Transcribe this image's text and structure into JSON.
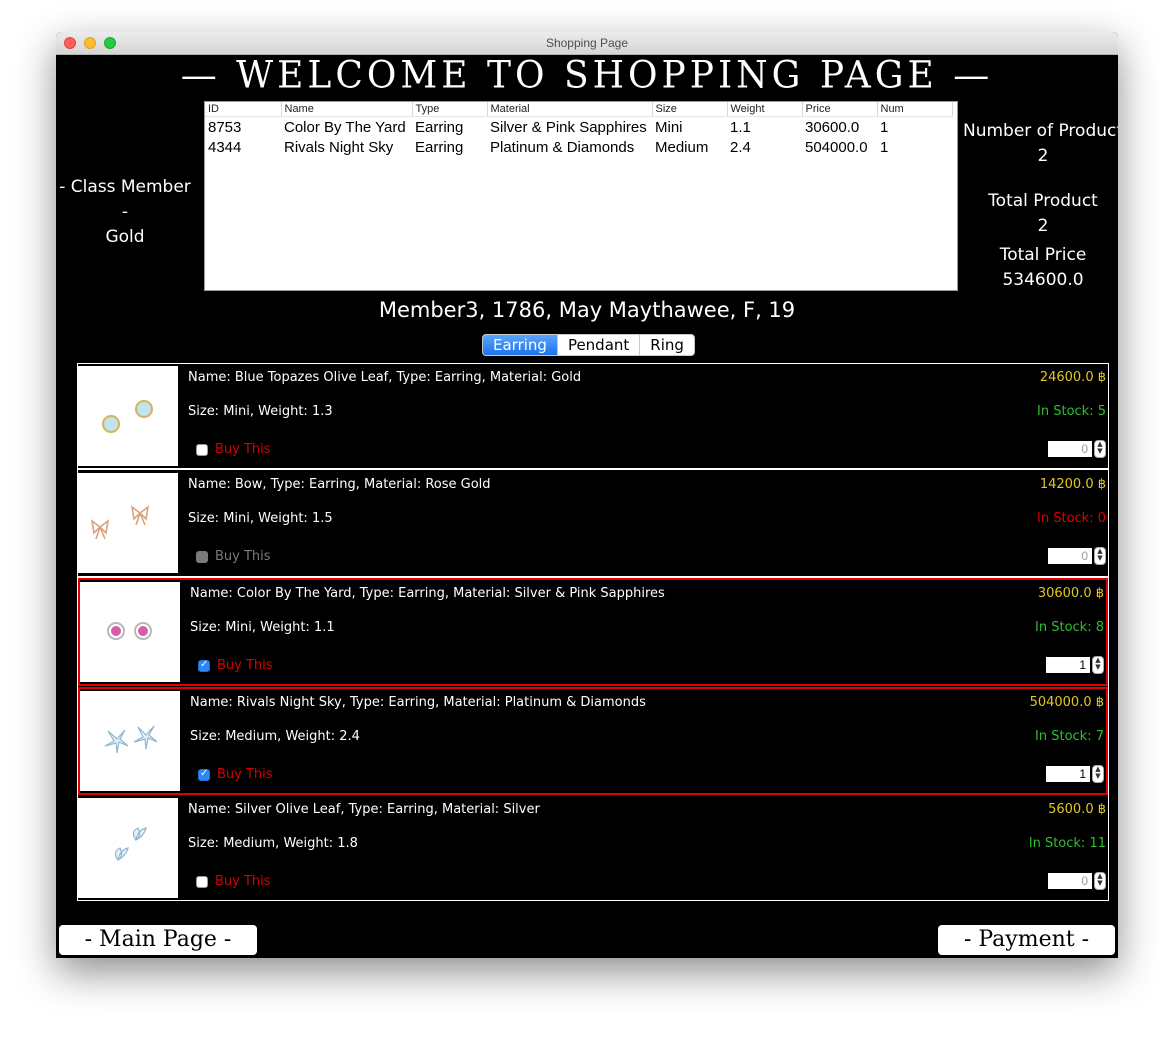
{
  "window": {
    "title": "Shopping Page"
  },
  "heading": "— WELCOME TO SHOPPING PAGE —",
  "member_class": {
    "label": "- Class Member -",
    "value": "Gold"
  },
  "cart_table": {
    "columns": [
      "ID",
      "Name",
      "Type",
      "Material",
      "Size",
      "Weight",
      "Price",
      "Num"
    ],
    "rows": [
      [
        "8753",
        "Color By The Yard",
        "Earring",
        "Silver & Pink Sapphires",
        "Mini",
        "1.1",
        "30600.0",
        "1"
      ],
      [
        "4344",
        "Rivals Night Sky",
        "Earring",
        "Platinum & Diamonds",
        "Medium",
        "2.4",
        "504000.0",
        "1"
      ]
    ]
  },
  "summary": {
    "num_product_label": "Number of Product",
    "num_product_value": "2",
    "total_product_label": "Total Product",
    "total_product_value": "2",
    "total_price_label": "Total Price",
    "total_price_value": "534600.0"
  },
  "member_info": "Member3, 1786, May Maythawee, F, 19",
  "tabs": [
    {
      "label": "Earring",
      "active": true
    },
    {
      "label": "Pendant",
      "active": false
    },
    {
      "label": "Ring",
      "active": false
    }
  ],
  "products": [
    {
      "name_line": "Name: Blue Topazes Olive Leaf, Type: Earring, Material: Gold",
      "size_line": "Size: Mini, Weight: 1.3",
      "price": "24600.0 ฿",
      "stock": "In Stock: 5",
      "buy_label": "Buy This",
      "qty": "0",
      "checked": false,
      "selected": false,
      "in_stock": true,
      "icon": "earring-icon"
    },
    {
      "name_line": "Name: Bow, Type: Earring, Material: Rose Gold",
      "size_line": "Size: Mini, Weight: 1.5",
      "price": "14200.0 ฿",
      "stock": "In Stock: 0",
      "buy_label": "Buy This",
      "qty": "0",
      "checked": false,
      "selected": false,
      "in_stock": false,
      "icon": "bow-earring-icon"
    },
    {
      "name_line": "Name: Color By The Yard, Type: Earring, Material: Silver & Pink Sapphires",
      "size_line": "Size: Mini, Weight: 1.1",
      "price": "30600.0 ฿",
      "stock": "In Stock: 8",
      "buy_label": "Buy This",
      "qty": "1",
      "checked": true,
      "selected": true,
      "in_stock": true,
      "icon": "stud-earring-icon"
    },
    {
      "name_line": "Name: Rivals Night Sky, Type: Earring, Material: Platinum & Diamonds",
      "size_line": "Size: Medium, Weight: 2.4",
      "price": "504000.0 ฿",
      "stock": "In Stock: 7",
      "buy_label": "Buy This",
      "qty": "1",
      "checked": true,
      "selected": true,
      "in_stock": true,
      "icon": "flower-earring-icon"
    },
    {
      "name_line": "Name: Silver Olive Leaf, Type: Earring, Material: Silver",
      "size_line": "Size: Medium, Weight: 1.8",
      "price": "5600.0 ฿",
      "stock": "In Stock: 11",
      "buy_label": "Buy This",
      "qty": "0",
      "checked": false,
      "selected": false,
      "in_stock": true,
      "icon": "leaf-earring-icon"
    }
  ],
  "buttons": {
    "main_page": "- Main Page -",
    "payment": "- Payment -"
  },
  "colors": {
    "background": "#000000",
    "price": "#e3c61e",
    "in_stock": "#2fbf2f",
    "out_of_stock": "#e00000",
    "buy_label": "#d50000",
    "selection_border": "#e00000",
    "tab_active": "#1c74ee"
  }
}
